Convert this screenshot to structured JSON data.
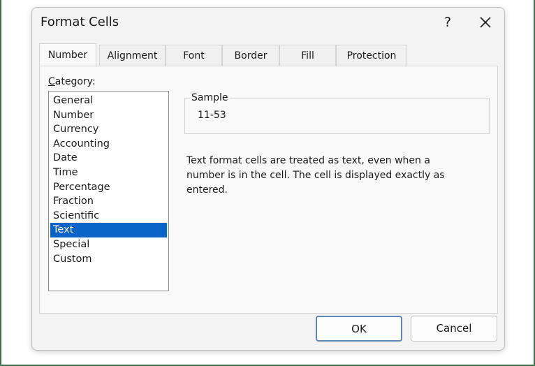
{
  "window": {
    "title": "Format Cells",
    "help_label": "?"
  },
  "tabs": [
    {
      "label": "Number",
      "active": true
    },
    {
      "label": "Alignment",
      "active": false
    },
    {
      "label": "Font",
      "active": false
    },
    {
      "label": "Border",
      "active": false
    },
    {
      "label": "Fill",
      "active": false
    },
    {
      "label": "Protection",
      "active": false
    }
  ],
  "category": {
    "label_prefix": "C",
    "label_rest": "ategory:",
    "items": [
      "General",
      "Number",
      "Currency",
      "Accounting",
      "Date",
      "Time",
      "Percentage",
      "Fraction",
      "Scientific",
      "Text",
      "Special",
      "Custom"
    ],
    "selected": "Text"
  },
  "sample": {
    "label": "Sample",
    "value": "11-53"
  },
  "description": "Text format cells are treated as text, even when a number is in the cell. The cell is displayed exactly as entered.",
  "buttons": {
    "ok_label": "OK",
    "cancel_label": "Cancel"
  },
  "colors": {
    "selection": "#0a64c8",
    "ok_border": "#5b87b7"
  }
}
